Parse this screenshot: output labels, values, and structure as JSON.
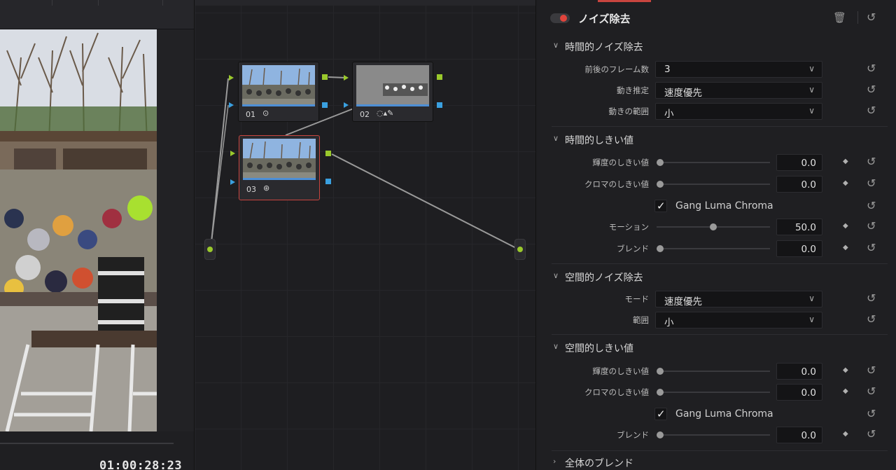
{
  "viewer": {
    "timecode": "01:00:28:23"
  },
  "nodes": [
    {
      "id": "node-01",
      "number": "01",
      "icon": "⊙"
    },
    {
      "id": "node-02",
      "number": "02",
      "icon": "◌▴✎"
    },
    {
      "id": "node-03",
      "number": "03",
      "icon": "⊛"
    }
  ],
  "inspector": {
    "title": "ノイズ除去",
    "toggle_on": true,
    "icons": {
      "delete": "trash-icon",
      "reset": "reset-icon"
    },
    "sections": {
      "temporal_nr": {
        "title": "時間的ノイズ除去",
        "frames_label": "前後のフレーム数",
        "frames_value": "3",
        "motion_est_label": "動き推定",
        "motion_est_value": "速度優先",
        "motion_range_label": "動きの範囲",
        "motion_range_value": "小"
      },
      "temporal_threshold": {
        "title": "時間的しきい値",
        "luma_label": "輝度のしきい値",
        "luma_value": "0.0",
        "chroma_label": "クロマのしきい値",
        "chroma_value": "0.0",
        "gang_label": "Gang Luma Chroma",
        "gang_checked": true,
        "motion_label": "モーション",
        "motion_value": "50.0",
        "blend_label": "ブレンド",
        "blend_value": "0.0"
      },
      "spatial_nr": {
        "title": "空間的ノイズ除去",
        "mode_label": "モード",
        "mode_value": "速度優先",
        "radius_label": "範囲",
        "radius_value": "小"
      },
      "spatial_threshold": {
        "title": "空間的しきい値",
        "luma_label": "輝度のしきい値",
        "luma_value": "0.0",
        "chroma_label": "クロマのしきい値",
        "chroma_value": "0.0",
        "gang_label": "Gang Luma Chroma",
        "gang_checked": true,
        "blend_label": "ブレンド",
        "blend_value": "0.0"
      },
      "global_blend": {
        "title": "全体のブレンド"
      }
    }
  },
  "colors": {
    "accent_red": "#e0443c",
    "node_selected": "#c9453f",
    "port_green": "#9ac92c",
    "port_blue": "#3aa0e0",
    "bar_blue": "#4d8fd6"
  }
}
